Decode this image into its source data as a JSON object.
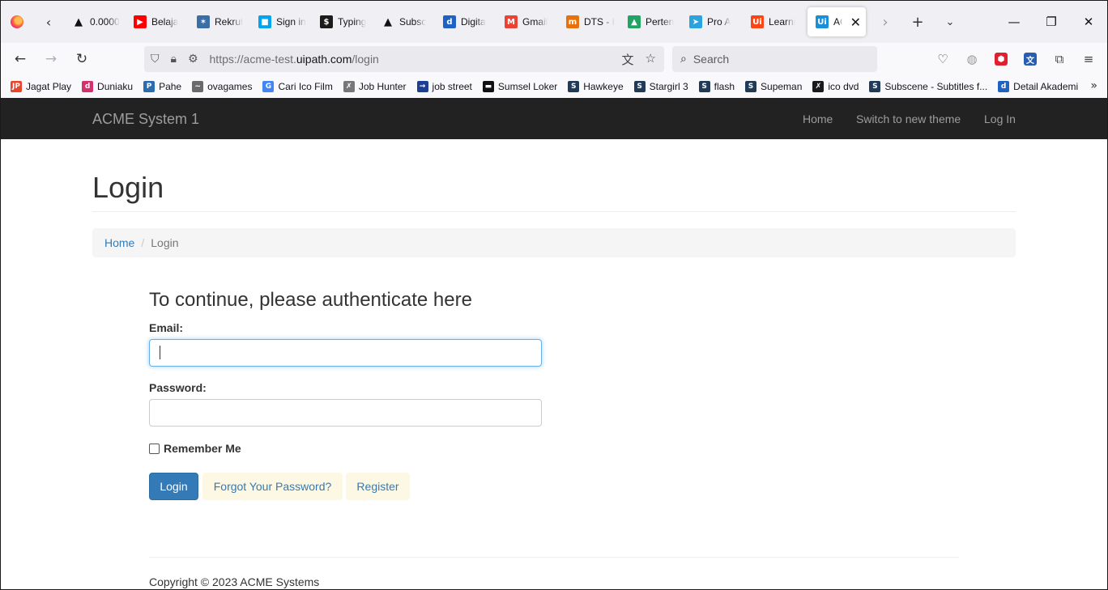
{
  "browser": {
    "tabs": [
      {
        "title": "0.0000",
        "icon": "warning-icon",
        "color": "#111111",
        "glyph": "▲"
      },
      {
        "title": "Belaja",
        "icon": "youtube-icon",
        "color": "#ff0000",
        "glyph": "▶"
      },
      {
        "title": "Rekrut",
        "icon": "star-logo-icon",
        "color": "#3a6ea5",
        "glyph": "✶"
      },
      {
        "title": "Sign in",
        "icon": "microsoft-icon",
        "color": "#00a4ef",
        "glyph": "■"
      },
      {
        "title": "Typing",
        "icon": "typing-icon",
        "color": "#1b1b1b",
        "glyph": "$"
      },
      {
        "title": "Subsc",
        "icon": "warning-icon",
        "color": "#111111",
        "glyph": "▲"
      },
      {
        "title": "Digita",
        "icon": "digitalent-icon",
        "color": "#1e63c4",
        "glyph": "d"
      },
      {
        "title": "Gmail",
        "icon": "gmail-icon",
        "color": "#ea4335",
        "glyph": "M"
      },
      {
        "title": "DTS - I",
        "icon": "dts-icon",
        "color": "#e8710a",
        "glyph": "m"
      },
      {
        "title": "Perten",
        "icon": "google-drive-icon",
        "color": "#1fa463",
        "glyph": "▲"
      },
      {
        "title": "Pro A",
        "icon": "telegram-icon",
        "color": "#2aa3e0",
        "glyph": "➤"
      },
      {
        "title": "Learni",
        "icon": "uipath-icon",
        "color": "#fa4616",
        "glyph": "Ui"
      },
      {
        "title": "AC",
        "icon": "uipath-icon",
        "color": "#1a8fd8",
        "glyph": "Ui",
        "active": true
      }
    ],
    "url": {
      "prefix": "https://acme-test.",
      "host": "uipath.com",
      "path": "/login"
    },
    "search_placeholder": "Search",
    "bookmarks": [
      {
        "label": "Jagat Play",
        "icon": "jagatplay-icon",
        "color": "#e8452c",
        "glyph": "JP"
      },
      {
        "label": "Duniaku",
        "icon": "duniaku-icon",
        "color": "#d6306b",
        "glyph": "d"
      },
      {
        "label": "Pahe",
        "icon": "pahe-icon",
        "color": "#2b6cb0",
        "glyph": "P"
      },
      {
        "label": "ovagames",
        "icon": "ovagames-icon",
        "color": "#6a6a6a",
        "glyph": "~"
      },
      {
        "label": "Cari Ico Film",
        "icon": "google-icon",
        "color": "#4285f4",
        "glyph": "G"
      },
      {
        "label": "Job Hunter",
        "icon": "jobhunter-icon",
        "color": "#777777",
        "glyph": "✗"
      },
      {
        "label": "job street",
        "icon": "jobstreet-icon",
        "color": "#1c3f94",
        "glyph": "→"
      },
      {
        "label": "Sumsel Loker",
        "icon": "sumselloker-icon",
        "color": "#111111",
        "glyph": "▬"
      },
      {
        "label": "Hawkeye",
        "icon": "subscene-icon",
        "color": "#1f3b57",
        "glyph": "S"
      },
      {
        "label": "Stargirl 3",
        "icon": "subscene-icon",
        "color": "#1f3b57",
        "glyph": "S"
      },
      {
        "label": "flash",
        "icon": "subscene-icon",
        "color": "#1f3b57",
        "glyph": "S"
      },
      {
        "label": "Supeman",
        "icon": "subscene-icon",
        "color": "#1f3b57",
        "glyph": "S"
      },
      {
        "label": "ico dvd",
        "icon": "icodvd-icon",
        "color": "#1a1a1a",
        "glyph": "✗"
      },
      {
        "label": "Subscene - Subtitles f...",
        "icon": "subscene-icon",
        "color": "#1f3b57",
        "glyph": "S"
      },
      {
        "label": "Detail Akademi",
        "icon": "digitalent-icon",
        "color": "#1e63c4",
        "glyph": "d"
      }
    ]
  },
  "site": {
    "brand": "ACME System 1",
    "nav": {
      "home": "Home",
      "switch_theme": "Switch to new theme",
      "login": "Log In"
    },
    "page_title": "Login",
    "breadcrumb": {
      "home": "Home",
      "current": "Login"
    },
    "form": {
      "title": "To continue, please authenticate here",
      "email_label": "Email:",
      "email_value": "",
      "password_label": "Password:",
      "password_value": "",
      "remember_label": "Remember Me",
      "login_button": "Login",
      "forgot_button": "Forgot Your Password?",
      "register_button": "Register"
    },
    "footer": "Copyright © 2023 ACME Systems"
  },
  "colors": {
    "navbar_bg": "#222222",
    "link": "#337ab7",
    "primary_button": "#337ab7",
    "warning_button_bg": "#fcf8e3"
  }
}
